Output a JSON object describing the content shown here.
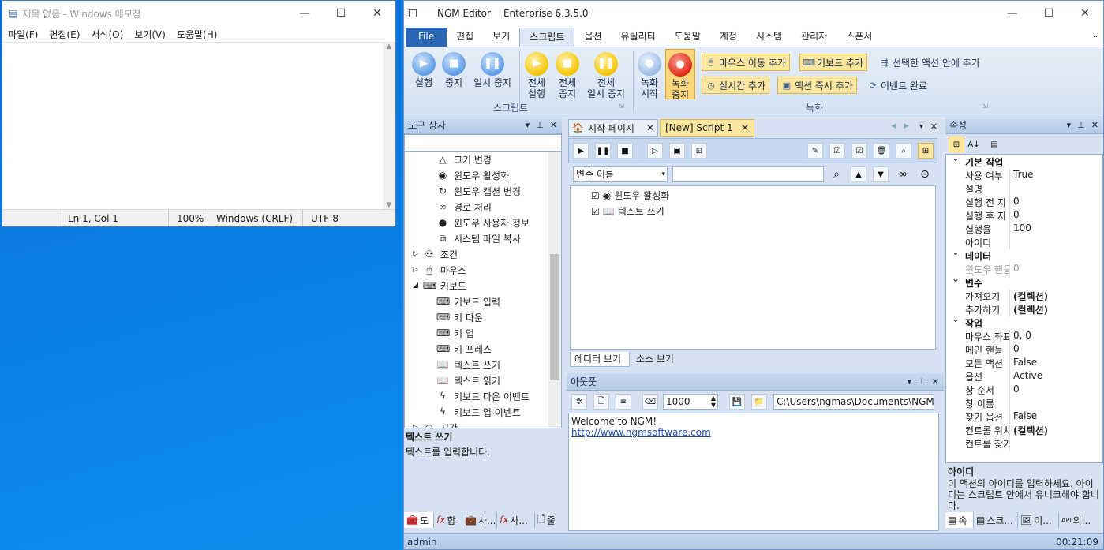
{
  "notepad": {
    "title": "제목 없음 - Windows 메모장",
    "menu": [
      "파일(F)",
      "편집(E)",
      "서식(O)",
      "보기(V)",
      "도움말(H)"
    ],
    "status": {
      "pos": "Ln 1, Col 1",
      "zoom": "100%",
      "eol": "Windows (CRLF)",
      "enc": "UTF-8"
    }
  },
  "ngm": {
    "title": "NGM Editor",
    "edition": "Enterprise 6.3.5.0",
    "tabs": [
      "File",
      "편집",
      "보기",
      "스크립트",
      "옵션",
      "유틸리티",
      "도움말",
      "계정",
      "시스템",
      "관리자",
      "스폰서"
    ],
    "active_tab": "스크립트",
    "ribbon": {
      "run": "실행",
      "stop": "중지",
      "pause": "일시 중지",
      "run_all_1": "전체",
      "run_all_2": "실행",
      "stop_all_1": "전체",
      "stop_all_2": "중지",
      "pause_all_1": "전체",
      "pause_all_2": "일시 중지",
      "group_script": "스크립트",
      "rec_start_1": "녹화",
      "rec_start_2": "시작",
      "rec_stop_1": "녹화",
      "rec_stop_2": "중지",
      "add_mouse": "마우스 이동 추가",
      "add_keyboard": "키보드 추가",
      "add_in_action": "선택한 액션 안에 추가",
      "add_realtime": "실시간 추가",
      "add_action_now": "액션 즉시 추가",
      "event_done": "이벤트 완료",
      "group_record": "녹화"
    },
    "toolbox": {
      "title": "도구 상자",
      "items": [
        {
          "icon": "△",
          "label": "크기 변경"
        },
        {
          "icon": "◉",
          "label": "윈도우 활성화"
        },
        {
          "icon": "↻",
          "label": "윈도우 캡션 변경"
        },
        {
          "icon": "∞",
          "label": "경로 처리"
        },
        {
          "icon": "●",
          "label": "윈도우 사용자 정보"
        },
        {
          "icon": "⧉",
          "label": "시스템 파일 복사"
        }
      ],
      "groups": [
        {
          "label": "조건",
          "icon": "⚇"
        },
        {
          "label": "마우스",
          "icon": "🖰"
        },
        {
          "label": "키보드",
          "icon": "⌨"
        }
      ],
      "kb_items": [
        "키보드 입력",
        "키 다운",
        "키 업",
        "키 프레스",
        "텍스트 쓰기",
        "텍스트 읽기",
        "키보드 다운 이벤트",
        "키보드 업 이벤트"
      ],
      "cut_item": "시간",
      "desc_title": "텍스트 쓰기",
      "desc_text": "텍스트를 입력합니다.",
      "bottom_tabs": [
        "도",
        "함",
        "사...",
        "사...",
        "줄"
      ]
    },
    "doc_tabs": [
      "시작 페이지",
      "[New] Script 1"
    ],
    "editor": {
      "var_select": "변수 이름",
      "lines": [
        "윈도우 활성화",
        "텍스트 쓰기"
      ],
      "view_tabs": [
        "에디터 보기",
        "소스 보기"
      ]
    },
    "output": {
      "title": "아웃풋",
      "count": "1000",
      "path": "C:\\Users\\ngmas\\Documents\\NGM6\\",
      "lines": [
        "Welcome to NGM!"
      ],
      "link": "http://www.ngmsoftware.com"
    },
    "props": {
      "title": "속성",
      "cat_basic": "기본 작업",
      "basic": [
        [
          "사용 여부",
          "True"
        ],
        [
          "설명",
          ""
        ],
        [
          "실행 전 지",
          "0"
        ],
        [
          "실행 후 지",
          "0"
        ],
        [
          "실행율",
          "100"
        ],
        [
          "아이디",
          ""
        ]
      ],
      "cat_data": "데이터",
      "data": [
        [
          "윈도우 핸들",
          "0"
        ]
      ],
      "cat_var": "변수",
      "var": [
        [
          "가져오기",
          "(컬렉션)"
        ],
        [
          "추가하기",
          "(컬렉션)"
        ]
      ],
      "cat_work": "작업",
      "work": [
        [
          "마우스 좌표",
          "0, 0"
        ],
        [
          "메인 핸들",
          "0"
        ],
        [
          "모든 액션",
          "False"
        ],
        [
          "옵션",
          "Active"
        ],
        [
          "창 순서",
          "0"
        ],
        [
          "창 이름",
          ""
        ],
        [
          "찾기 옵션",
          "False"
        ],
        [
          "컨트롤 위치",
          "(컬렉션)"
        ],
        [
          "컨트롤 찾기",
          ""
        ]
      ],
      "desc_title": "아이디",
      "desc_text": "이 액션의 아이디를 입력하세요. 아이디는 스크립트 안에서 유니크해야 합니다.",
      "bottom_tabs": [
        "속",
        "스크...",
        "이...",
        "외..."
      ]
    },
    "status_user": "admin",
    "status_time": "00:21:09"
  }
}
